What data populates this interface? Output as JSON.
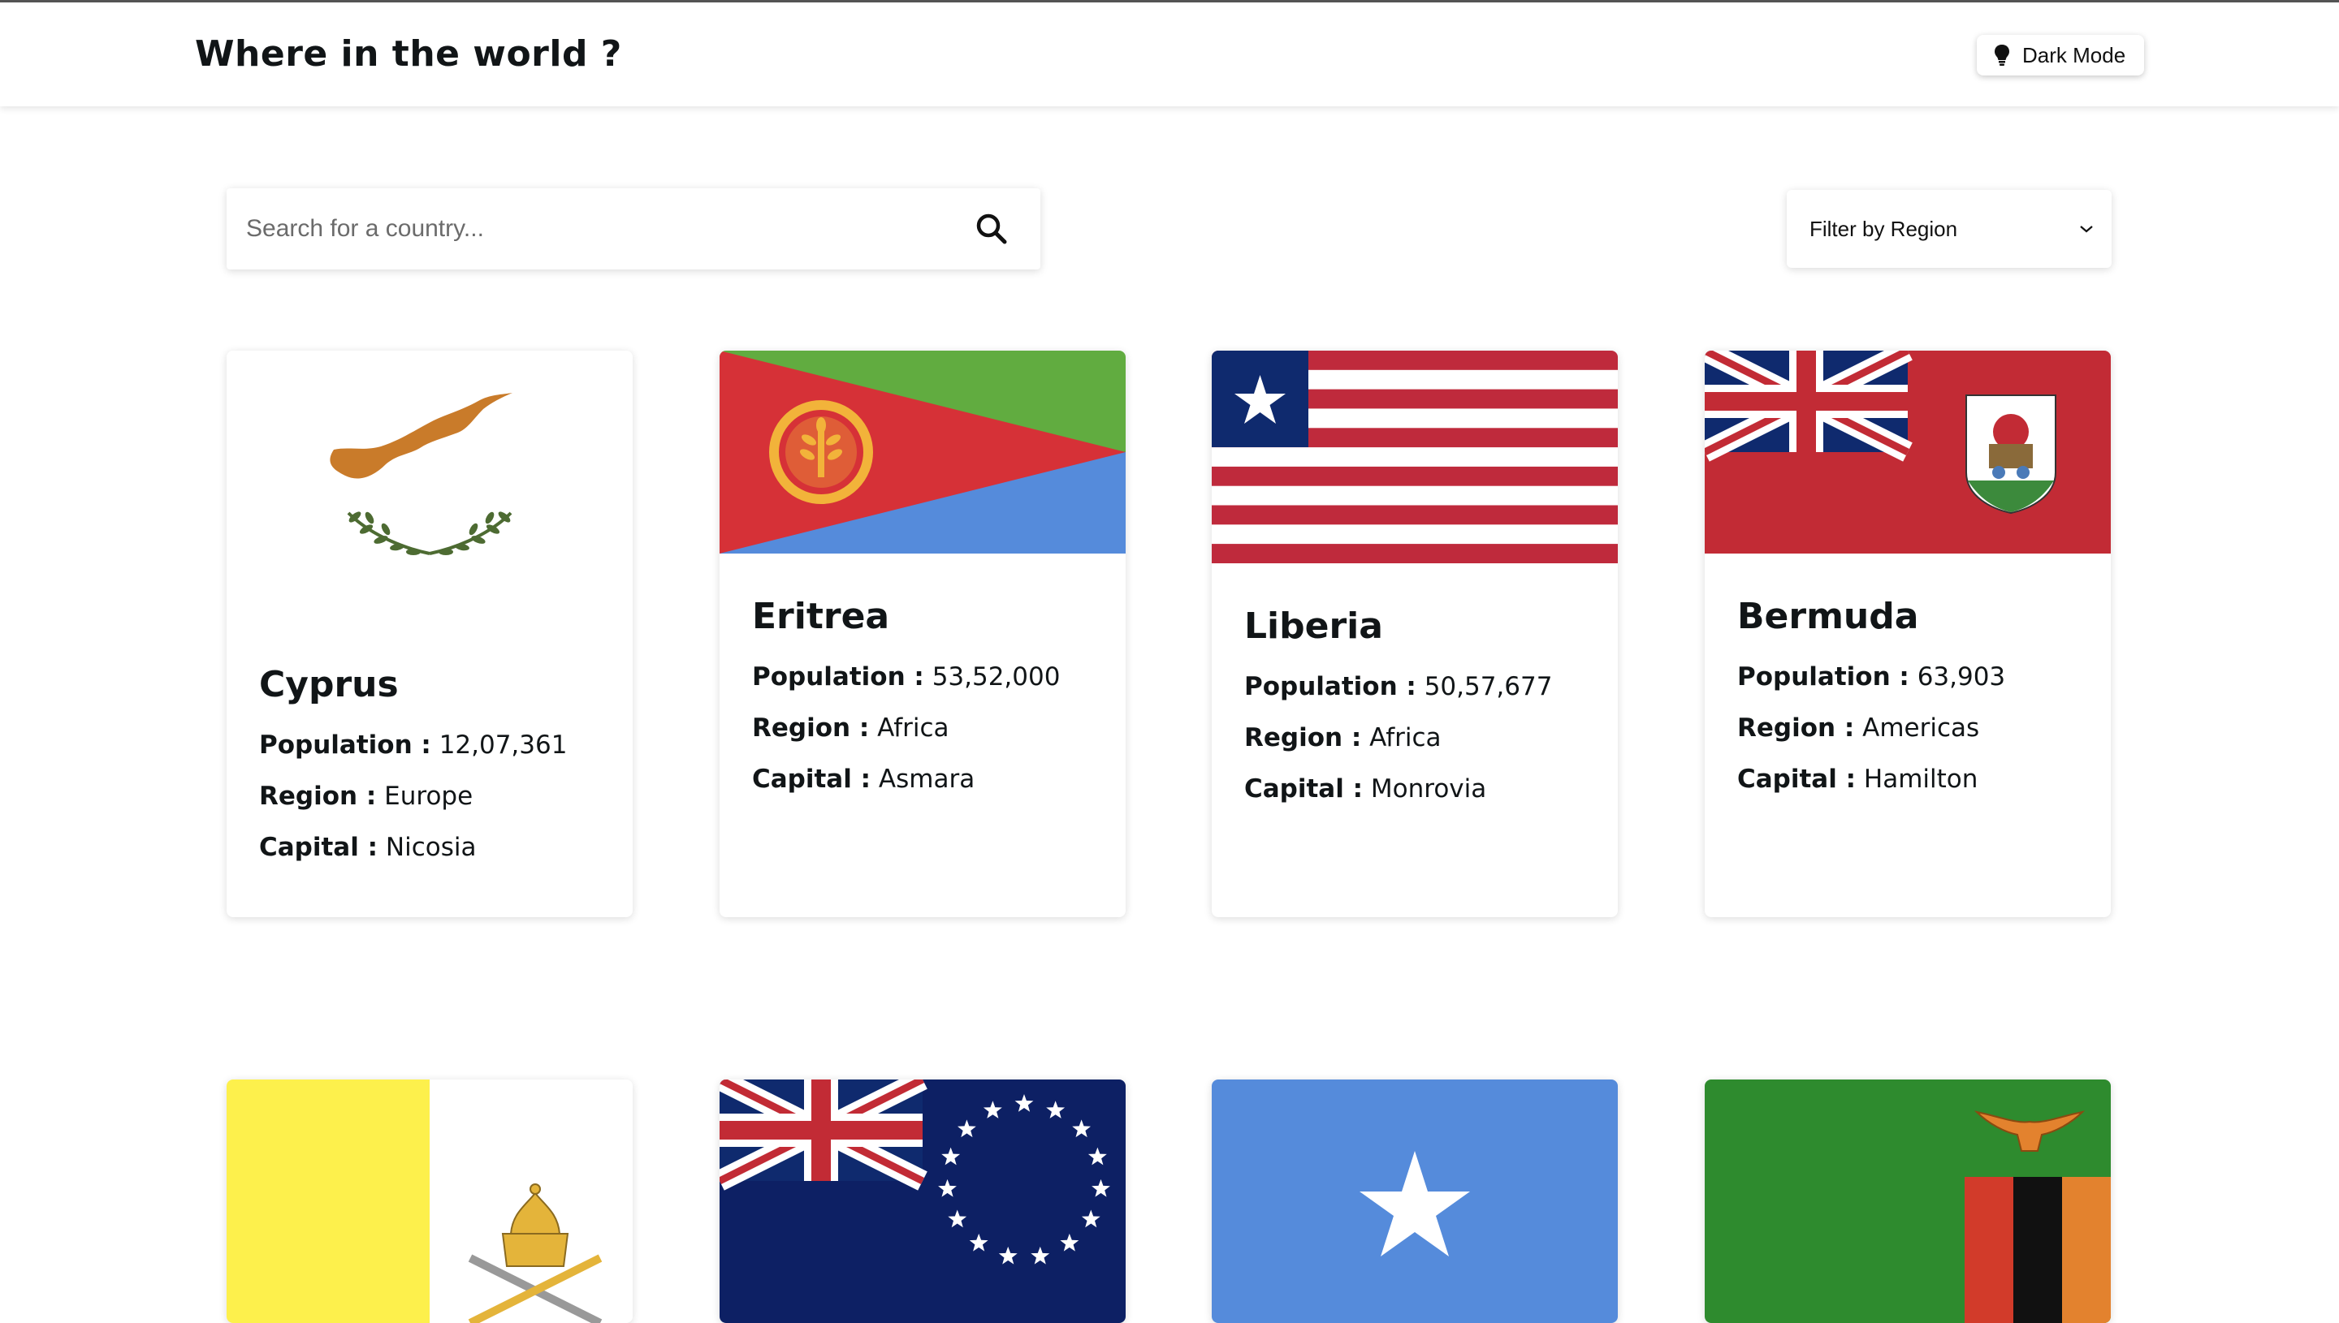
{
  "header": {
    "title": "Where in the world ?",
    "theme_toggle_label": "Dark Mode"
  },
  "search": {
    "placeholder": "Search for a country...",
    "value": ""
  },
  "filter": {
    "label": "Filter by Region"
  },
  "labels": {
    "population": "Population :",
    "region": "Region :",
    "capital": "Capital :"
  },
  "countries": [
    {
      "name": "Cyprus",
      "population": "12,07,361",
      "region": "Europe",
      "capital": "Nicosia",
      "flag_icon": "flag-cyprus-icon"
    },
    {
      "name": "Eritrea",
      "population": "53,52,000",
      "region": "Africa",
      "capital": "Asmara",
      "flag_icon": "flag-eritrea-icon"
    },
    {
      "name": "Liberia",
      "population": "50,57,677",
      "region": "Africa",
      "capital": "Monrovia",
      "flag_icon": "flag-liberia-icon"
    },
    {
      "name": "Bermuda",
      "population": "63,903",
      "region": "Americas",
      "capital": "Hamilton",
      "flag_icon": "flag-bermuda-icon"
    },
    {
      "flag_icon": "flag-vatican-icon"
    },
    {
      "flag_icon": "flag-cook-islands-icon"
    },
    {
      "flag_icon": "flag-somalia-icon"
    },
    {
      "flag_icon": "flag-zambia-icon"
    }
  ],
  "colors": {
    "text": "#111517",
    "background": "#ffffff"
  }
}
